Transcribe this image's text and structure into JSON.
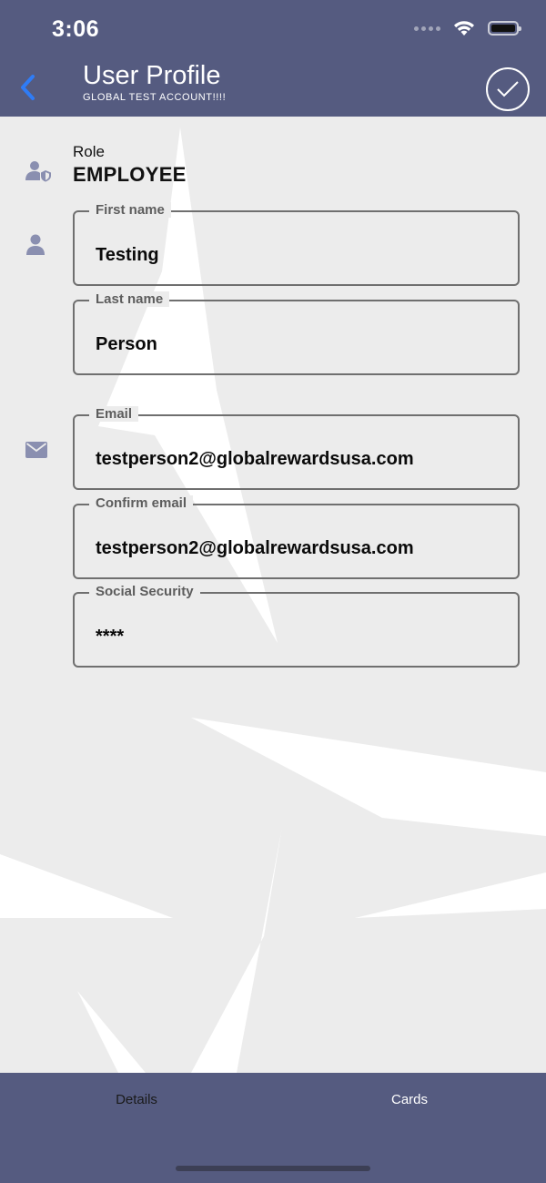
{
  "status_bar": {
    "time": "3:06"
  },
  "header": {
    "title": "User Profile",
    "subtitle": "GLOBAL TEST ACCOUNT!!!!",
    "back_icon": "chevron-left-icon",
    "done_icon": "check-circle-icon"
  },
  "role": {
    "label": "Role",
    "value": "EMPLOYEE"
  },
  "fields": {
    "first_name": {
      "label": "First name",
      "value": "Testing"
    },
    "last_name": {
      "label": "Last name",
      "value": "Person"
    },
    "email": {
      "label": "Email",
      "value": "testperson2@globalrewardsusa.com"
    },
    "confirm_email": {
      "label": "Confirm email",
      "value": "testperson2@globalrewardsusa.com"
    },
    "social_security": {
      "label": "Social Security",
      "value": "****"
    }
  },
  "tabs": {
    "details": "Details",
    "cards": "Cards"
  },
  "colors": {
    "header": "#555b80",
    "icon": "#8a8fb0",
    "background": "#ececec",
    "back_accent": "#2f7cf6"
  }
}
